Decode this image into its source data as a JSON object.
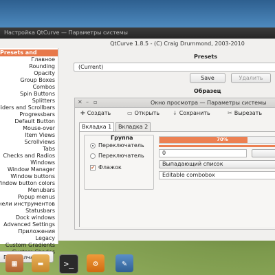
{
  "window": {
    "title": "Настройка QtCurve — Параметры системы",
    "about": "QtCurve 1.8.5 - (C) Craig Drummond, 2003-2010"
  },
  "sidebar": {
    "items": [
      {
        "label": "Presets and Preview",
        "selected": true
      },
      {
        "label": "Главное"
      },
      {
        "label": "Rounding"
      },
      {
        "label": "Opacity"
      },
      {
        "label": "Group Boxes"
      },
      {
        "label": "Combos"
      },
      {
        "label": "Spin Buttons"
      },
      {
        "label": "Splitters"
      },
      {
        "label": "Sliders and Scrollbars"
      },
      {
        "label": "Progressbars"
      },
      {
        "label": "Default Button"
      },
      {
        "label": "Mouse-over"
      },
      {
        "label": "Item Views"
      },
      {
        "label": "Scrollviews"
      },
      {
        "label": "Tabs"
      },
      {
        "label": "Checks and Radios"
      },
      {
        "label": "Windows"
      },
      {
        "label": "Window Manager"
      },
      {
        "label": "Window buttons"
      },
      {
        "label": "Window button colors"
      },
      {
        "label": "Menubars"
      },
      {
        "label": "Popup menus"
      },
      {
        "label": "Панели инструментов"
      },
      {
        "label": "Statusbars"
      },
      {
        "label": "Dock windows"
      },
      {
        "label": "Advanced Settings"
      },
      {
        "label": "Приложения"
      },
      {
        "label": "Legacy"
      },
      {
        "label": "Custom Gradients"
      },
      {
        "label": "Custom Shades"
      }
    ],
    "defaults_button": "По умолчанию"
  },
  "presets": {
    "heading": "Presets",
    "current": "(Current)",
    "save_label": "Save",
    "delete_label": "Удалить"
  },
  "sample": {
    "heading": "Образец",
    "window_title": "Окно просмотра — Параметры системы",
    "toolbar": {
      "create": "Создать",
      "open": "Открыть",
      "save": "Сохранить",
      "cut": "Вырезать"
    },
    "tabs": [
      "Вкладка 1",
      "Вкладка 2"
    ],
    "group_title": "Группа",
    "radio1": "Переключатель",
    "radio2": "Переключатель",
    "checkbox": "Флажок",
    "progress": {
      "value": 70,
      "label": "70%"
    },
    "spin_value": "0",
    "combo_value": "Выпадающий список",
    "editable_combo": "Editable combobox"
  },
  "colors": {
    "accent": "#ec8052",
    "selection": "#e7784a"
  },
  "dock": {
    "icons": [
      "file-manager-icon",
      "folder-icon",
      "terminal-icon",
      "settings-gears-icon",
      "system-settings-icon"
    ]
  }
}
